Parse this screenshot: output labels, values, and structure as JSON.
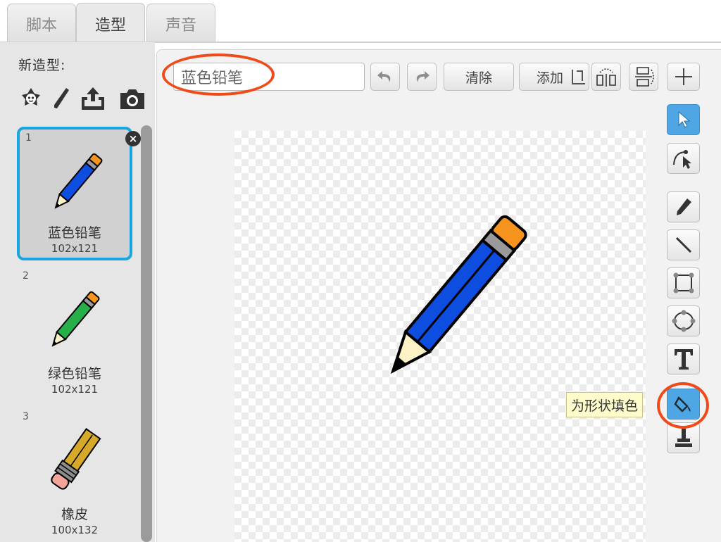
{
  "tabs": [
    {
      "label": "脚本",
      "active": false
    },
    {
      "label": "造型",
      "active": true
    },
    {
      "label": "声音",
      "active": false
    }
  ],
  "new_costume": {
    "label": "新造型:",
    "icons": [
      "sprite-library-icon",
      "paint-brush-icon",
      "upload-icon",
      "camera-icon"
    ]
  },
  "costumes": [
    {
      "number": "1",
      "name": "蓝色铅笔",
      "size": "102x121",
      "selected": true
    },
    {
      "number": "2",
      "name": "绿色铅笔",
      "size": "102x121",
      "selected": false
    },
    {
      "number": "3",
      "name": "橡皮",
      "size": "100x132",
      "selected": false
    }
  ],
  "editor": {
    "name_value": "蓝色铅笔",
    "clear_label": "清除",
    "add_label": "添加",
    "tools": [
      "select-icon",
      "reshape-icon",
      "pencil-icon",
      "line-icon",
      "rectangle-icon",
      "ellipse-icon",
      "text-icon",
      "fill-icon",
      "stamp-icon"
    ],
    "active_tool": "fill-icon",
    "tooltip": "为形状填色"
  },
  "colors": {
    "accent_blue": "#19a6e0",
    "highlight_ring": "#f04a18",
    "pencil_blue": "#0d4de0",
    "pencil_green": "#27b04a",
    "eraser_gold": "#d6a92a",
    "eraser_pink": "#f4a59a",
    "pencil_cap": "#f7941d"
  }
}
